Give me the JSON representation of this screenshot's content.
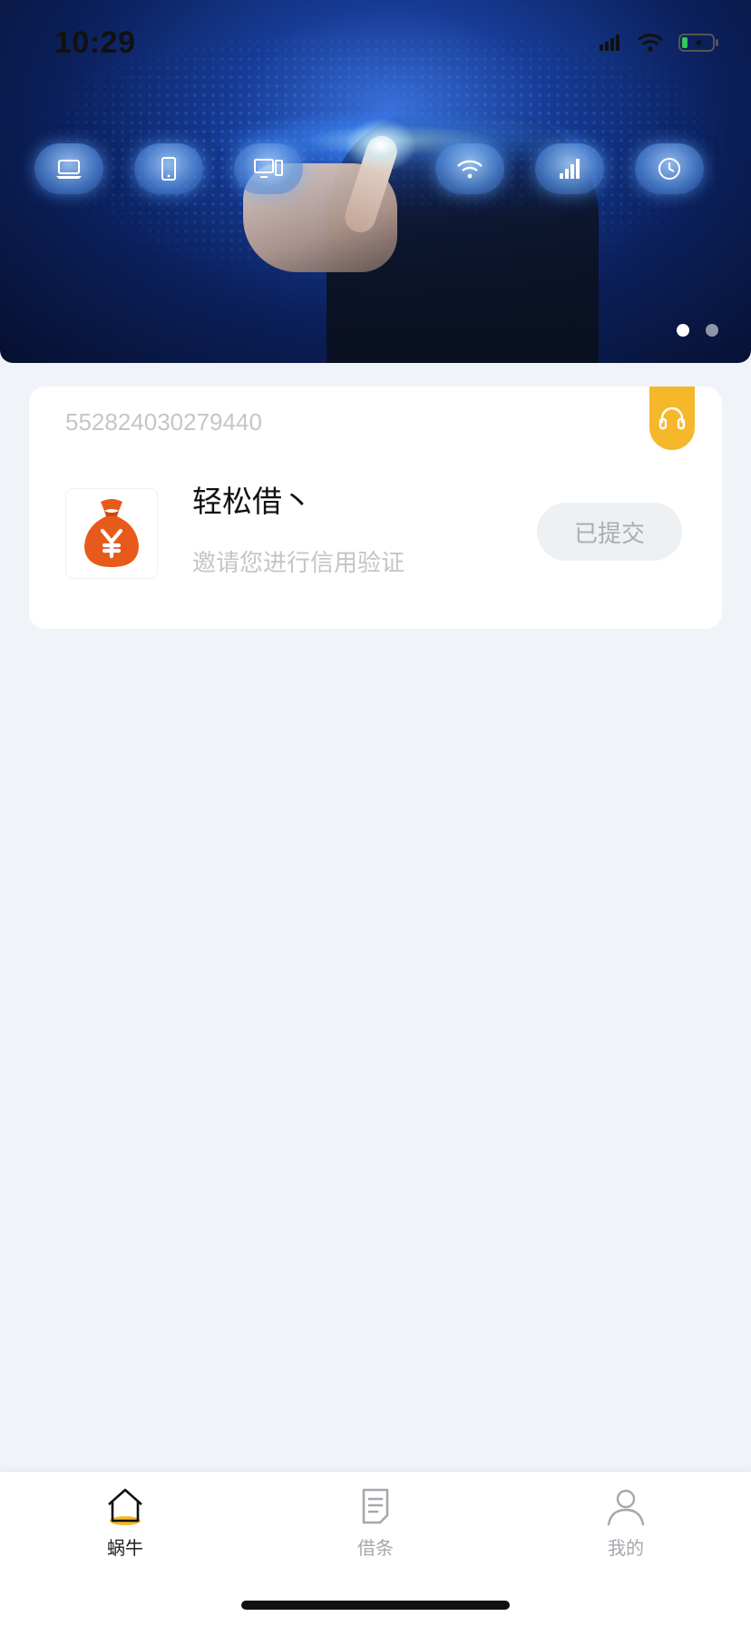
{
  "status_bar": {
    "time": "10:29"
  },
  "banner": {
    "icons": [
      "laptop-icon",
      "tablet-icon",
      "desktop-icon",
      "cloud-icon",
      "wifi-icon",
      "signal-icon",
      "clock-icon"
    ],
    "slide_count": 2,
    "active_slide": 1
  },
  "card": {
    "order_number": "552824030279440",
    "product_name": "轻松借丶",
    "description": "邀请您进行信用验证",
    "status_button": "已提交",
    "accent_color": "#f5b82a",
    "logo_color": "#e85a1b"
  },
  "tabbar": {
    "tabs": [
      {
        "label": "蜗牛",
        "icon": "home-icon",
        "active": true
      },
      {
        "label": "借条",
        "icon": "document-icon",
        "active": false
      },
      {
        "label": "我的",
        "icon": "user-icon",
        "active": false
      }
    ]
  }
}
